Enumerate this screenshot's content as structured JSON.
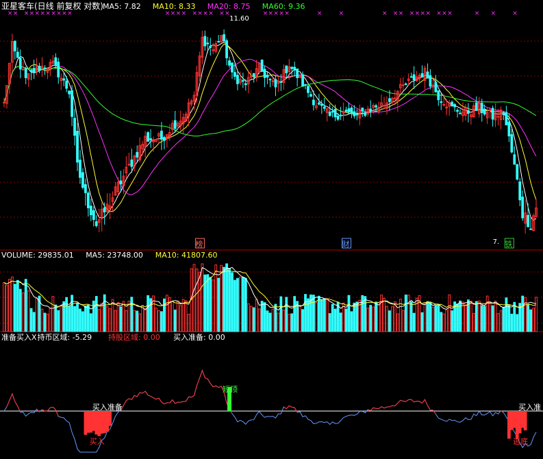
{
  "header": {
    "name": "亚星客车(日线 前复权 对数)",
    "items": [
      {
        "label": "MA5: 7.82",
        "color": "#ffffff"
      },
      {
        "label": "MA10: 8.33",
        "color": "#ffff33"
      },
      {
        "label": "MA20: 8.75",
        "color": "#ff33ff"
      },
      {
        "label": "MA60: 9.36",
        "color": "#33ff33"
      }
    ]
  },
  "price_panel": {
    "high_label": "11.60",
    "low_label": "7.",
    "badges": [
      {
        "label": "榜",
        "day": 72,
        "color": "#ff6666"
      },
      {
        "label": "财",
        "day": 126,
        "color": "#6699ff"
      },
      {
        "label": "铁",
        "day": 186,
        "color": "#33cc33"
      }
    ]
  },
  "volume_header": {
    "items": [
      {
        "label": "VOLUME: 29835.01",
        "color": "#ffffff"
      },
      {
        "label": "MA5: 23748.00",
        "color": "#ffffff"
      },
      {
        "label": "MA10: 41807.60",
        "color": "#ffff33"
      }
    ]
  },
  "indicator_header": {
    "items": [
      {
        "label": "准备买入X",
        "color": "#ffffff"
      },
      {
        "label": "持币区域: -5.29",
        "color": "#ffffff"
      },
      {
        "label": "持股区域: 0.00",
        "color": "#ff3333"
      },
      {
        "label": "买入准备: 0.00",
        "color": "#ffffff"
      }
    ]
  },
  "indicator_labels": [
    {
      "text": "买入准备",
      "day": 35,
      "color": "#ffffff"
    },
    {
      "text": "短顶",
      "day": 83,
      "color": "#33ff33"
    },
    {
      "text": "买入准",
      "day": 192,
      "color": "#ffffff"
    },
    {
      "text": "逃底",
      "day": 190,
      "color": "#ff3333"
    },
    {
      "text": "买入",
      "day": 34,
      "color": "#ff3333"
    }
  ],
  "chart_data": {
    "type": "candlestick",
    "days": 197,
    "ohlc_keypoints": [
      [
        0,
        9.6
      ],
      [
        3,
        11.1
      ],
      [
        8,
        10.2
      ],
      [
        12,
        10.5
      ],
      [
        18,
        10.6
      ],
      [
        24,
        9.9
      ],
      [
        27,
        8.2
      ],
      [
        30,
        7.6
      ],
      [
        34,
        7.1
      ],
      [
        38,
        7.4
      ],
      [
        42,
        7.8
      ],
      [
        47,
        8.3
      ],
      [
        52,
        8.8
      ],
      [
        58,
        8.8
      ],
      [
        62,
        9.1
      ],
      [
        66,
        9.3
      ],
      [
        70,
        9.8
      ],
      [
        73,
        11.3
      ],
      [
        77,
        11.0
      ],
      [
        80,
        11.4
      ],
      [
        84,
        10.3
      ],
      [
        89,
        10.1
      ],
      [
        94,
        10.5
      ],
      [
        100,
        10.0
      ],
      [
        105,
        10.6
      ],
      [
        110,
        10.1
      ],
      [
        115,
        9.6
      ],
      [
        120,
        9.3
      ],
      [
        125,
        9.4
      ],
      [
        130,
        9.3
      ],
      [
        135,
        9.5
      ],
      [
        140,
        9.6
      ],
      [
        145,
        9.9
      ],
      [
        150,
        10.2
      ],
      [
        155,
        10.4
      ],
      [
        160,
        9.8
      ],
      [
        165,
        9.5
      ],
      [
        170,
        9.4
      ],
      [
        175,
        9.5
      ],
      [
        180,
        9.3
      ],
      [
        184,
        9.4
      ],
      [
        188,
        8.2
      ],
      [
        191,
        7.3
      ],
      [
        194,
        7.1
      ],
      [
        196,
        7.4
      ]
    ],
    "ma_lines": [
      "MA5",
      "MA10",
      "MA20",
      "MA60"
    ],
    "ma_colors": [
      "#ffffff",
      "#ffff33",
      "#ff33ff",
      "#33ff33"
    ],
    "volume_ma": [
      "MA5",
      "MA10"
    ]
  },
  "colors": {
    "up": "#ff3333",
    "down": "#33ffff",
    "grid": "#8b0000",
    "axis_frame": "#b00000",
    "cross": "#ff33ff"
  }
}
